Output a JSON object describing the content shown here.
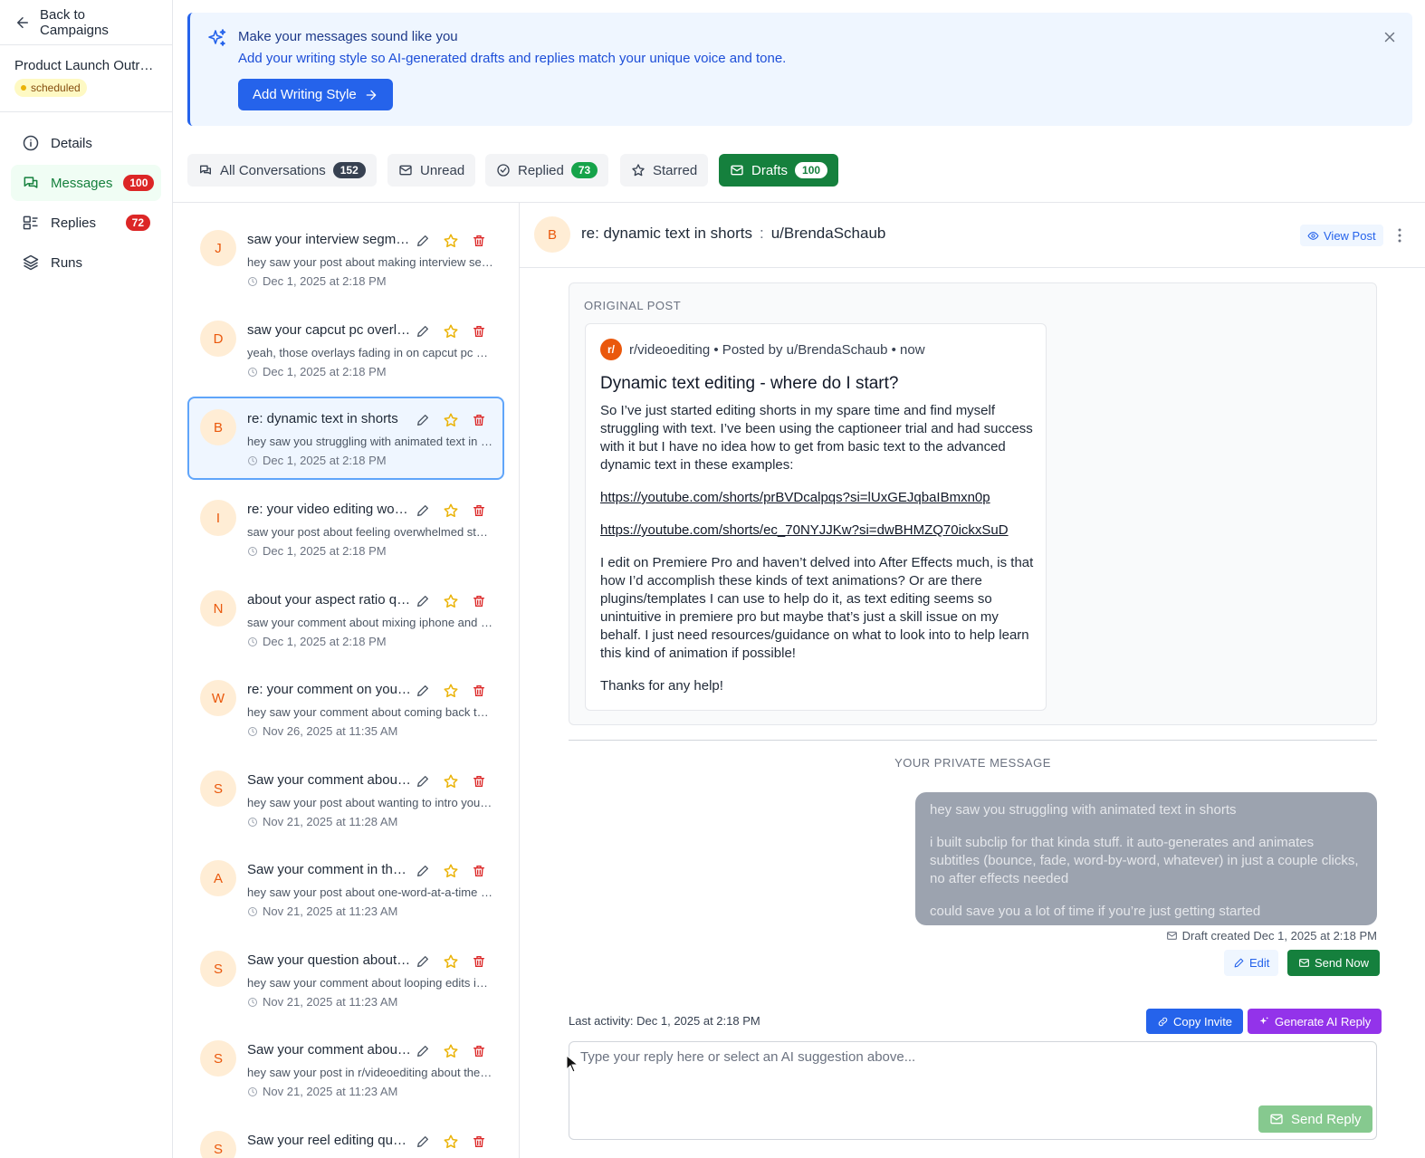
{
  "sidebar": {
    "back_label": "Back to Campaigns",
    "campaign_name": "Product Launch Outreach",
    "status": "scheduled",
    "nav": [
      {
        "label": "Details",
        "icon": "info-icon",
        "count": ""
      },
      {
        "label": "Messages",
        "icon": "messages-icon",
        "count": "100"
      },
      {
        "label": "Replies",
        "icon": "replies-icon",
        "count": "72"
      },
      {
        "label": "Runs",
        "icon": "layers-icon",
        "count": ""
      }
    ]
  },
  "banner": {
    "title": "Make your messages sound like you",
    "subtitle": "Add your writing style so AI-generated drafts and replies match your unique voice and tone.",
    "button_label": "Add Writing Style"
  },
  "tabs": [
    {
      "label": "All Conversations",
      "count": "152"
    },
    {
      "label": "Unread",
      "count": ""
    },
    {
      "label": "Replied",
      "count": "73"
    },
    {
      "label": "Starred",
      "count": ""
    },
    {
      "label": "Drafts",
      "count": "100"
    }
  ],
  "conversations": [
    {
      "initial": "J",
      "title": "saw your interview segment",
      "preview": "hey saw your post about making interview segments",
      "date": "Dec 1, 2025 at 2:18 PM"
    },
    {
      "initial": "D",
      "title": "saw your capcut pc overlays",
      "preview": "yeah, those overlays fading in on capcut pc are tricky",
      "date": "Dec 1, 2025 at 2:18 PM"
    },
    {
      "initial": "B",
      "title": "re: dynamic text in shorts",
      "preview": "hey saw you struggling with animated text in shorts",
      "date": "Dec 1, 2025 at 2:18 PM"
    },
    {
      "initial": "I",
      "title": "re: your video editing workflow",
      "preview": "saw your post about feeling overwhelmed starting out",
      "date": "Dec 1, 2025 at 2:18 PM"
    },
    {
      "initial": "N",
      "title": "about your aspect ratio question",
      "preview": "saw your comment about mixing iphone and camera footage",
      "date": "Dec 1, 2025 at 2:18 PM"
    },
    {
      "initial": "W",
      "title": "re: your comment on youtube",
      "preview": "hey saw your comment about coming back to editing",
      "date": "Nov 26, 2025 at 11:35 AM"
    },
    {
      "initial": "S",
      "title": "Saw your comment about intros",
      "preview": "hey saw your post about wanting to intro your videos",
      "date": "Nov 21, 2025 at 11:28 AM"
    },
    {
      "initial": "A",
      "title": "Saw your comment in the thread",
      "preview": "hey saw your post about one-word-at-a-time captions",
      "date": "Nov 21, 2025 at 11:23 AM"
    },
    {
      "initial": "S",
      "title": "Saw your question about loops",
      "preview": "hey saw your comment about looping edits in shorts",
      "date": "Nov 21, 2025 at 11:23 AM"
    },
    {
      "initial": "S",
      "title": "Saw your comment about captions",
      "preview": "hey saw your post in r/videoediting about the captions",
      "date": "Nov 21, 2025 at 11:23 AM"
    },
    {
      "initial": "S",
      "title": "Saw your reel editing question",
      "preview": "",
      "date": ""
    }
  ],
  "detail": {
    "initial": "B",
    "subject": "re: dynamic text in shorts",
    "separator": ":",
    "username": "u/BrendaSchaub",
    "view_post_label": "View Post",
    "original_post_label": "ORIGINAL POST",
    "post": {
      "subreddit_icon": "r/",
      "meta": "r/videoediting • Posted by u/BrendaSchaub • now",
      "title": "Dynamic text editing - where do I start?",
      "paragraph1": "So I’ve just started editing shorts in my spare time and find myself struggling with text. I’ve been using the captioneer trial and had success with it but I have no idea how to get from basic text to the advanced dynamic text in these examples:",
      "link1": "https://youtube.com/shorts/prBVDcalpqs?si=lUxGEJqbaIBmxn0p",
      "link2": "https://youtube.com/shorts/ec_70NYJJKw?si=dwBHMZQ70ickxSuD",
      "paragraph2": "I edit on Premiere Pro and haven’t delved into After Effects much, is that how I’d accomplish these kinds of text animations? Or are there plugins/templates I can use to help do it, as text editing seems so unintuitive in premiere pro but maybe that’s just a skill issue on my behalf. I just need resources/guidance on what to look into to help learn this kind of animation if possible!",
      "paragraph3": "Thanks for any help!"
    },
    "private_message_label": "YOUR PRIVATE MESSAGE",
    "message": {
      "line1": "hey saw you struggling with animated text in shorts",
      "line2": "i built subclip for that kinda stuff. it auto-generates and animates subtitles (bounce, fade, word-by-word, whatever) in just a couple clicks, no after effects needed",
      "line3": "could save you a lot of time if you’re just getting started"
    },
    "draft_info": "Draft created Dec 1, 2025 at 2:18 PM",
    "edit_label": "Edit",
    "send_now_label": "Send Now",
    "last_activity": "Last activity: Dec 1, 2025 at 2:18 PM",
    "copy_invite_label": "Copy Invite",
    "generate_ai_label": "Generate AI Reply",
    "reply_placeholder": "Type your reply here or select an AI suggestion above...",
    "send_reply_label": "Send Reply"
  }
}
